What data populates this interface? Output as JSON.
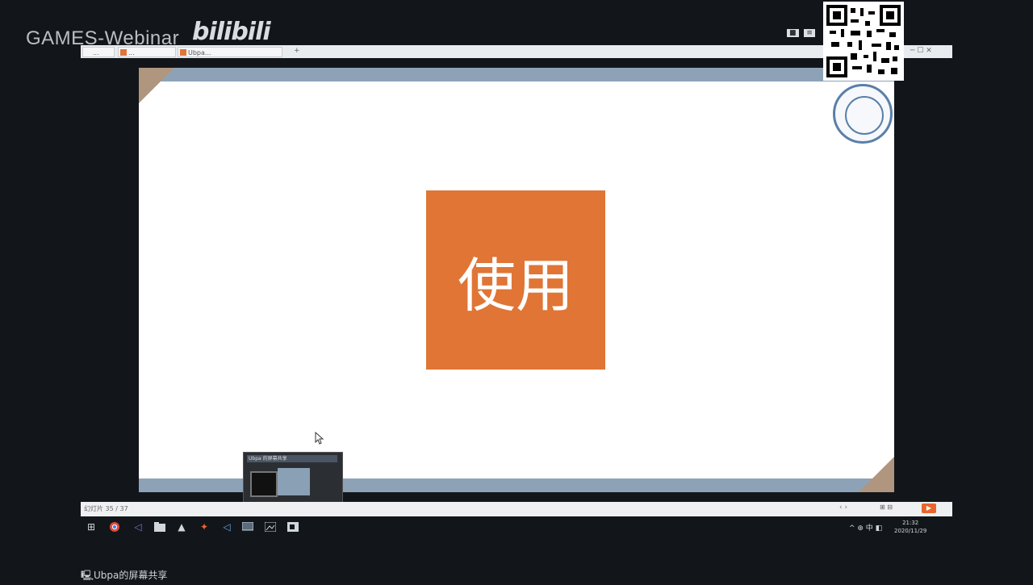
{
  "overlay": {
    "stream_title": "GAMES-Webinar",
    "bilibili_logo": "bilibili"
  },
  "browser": {
    "tabs": [
      {
        "label": "..."
      },
      {
        "label": "..."
      },
      {
        "label": "Ubpa..."
      }
    ],
    "new_tab": "+",
    "toolbar_buttons": [
      "■",
      "≡"
    ]
  },
  "slide": {
    "box_text": "使用",
    "accent_color": "#e07535",
    "frame_color": "#8ea2b7"
  },
  "popup": {
    "title": "Ubpa 的屏幕共享"
  },
  "statusbar": {
    "left_text": "幻灯片 35 / 37",
    "nav": "‹ ›",
    "zoom": "⊞ ⊟",
    "play_icon": "play-icon"
  },
  "taskbar": {
    "tray_text": "^ ⊕ 中 ◧",
    "time": "21:32",
    "date": "2020/11/29"
  },
  "share_label": "Ubpa的屏幕共享"
}
